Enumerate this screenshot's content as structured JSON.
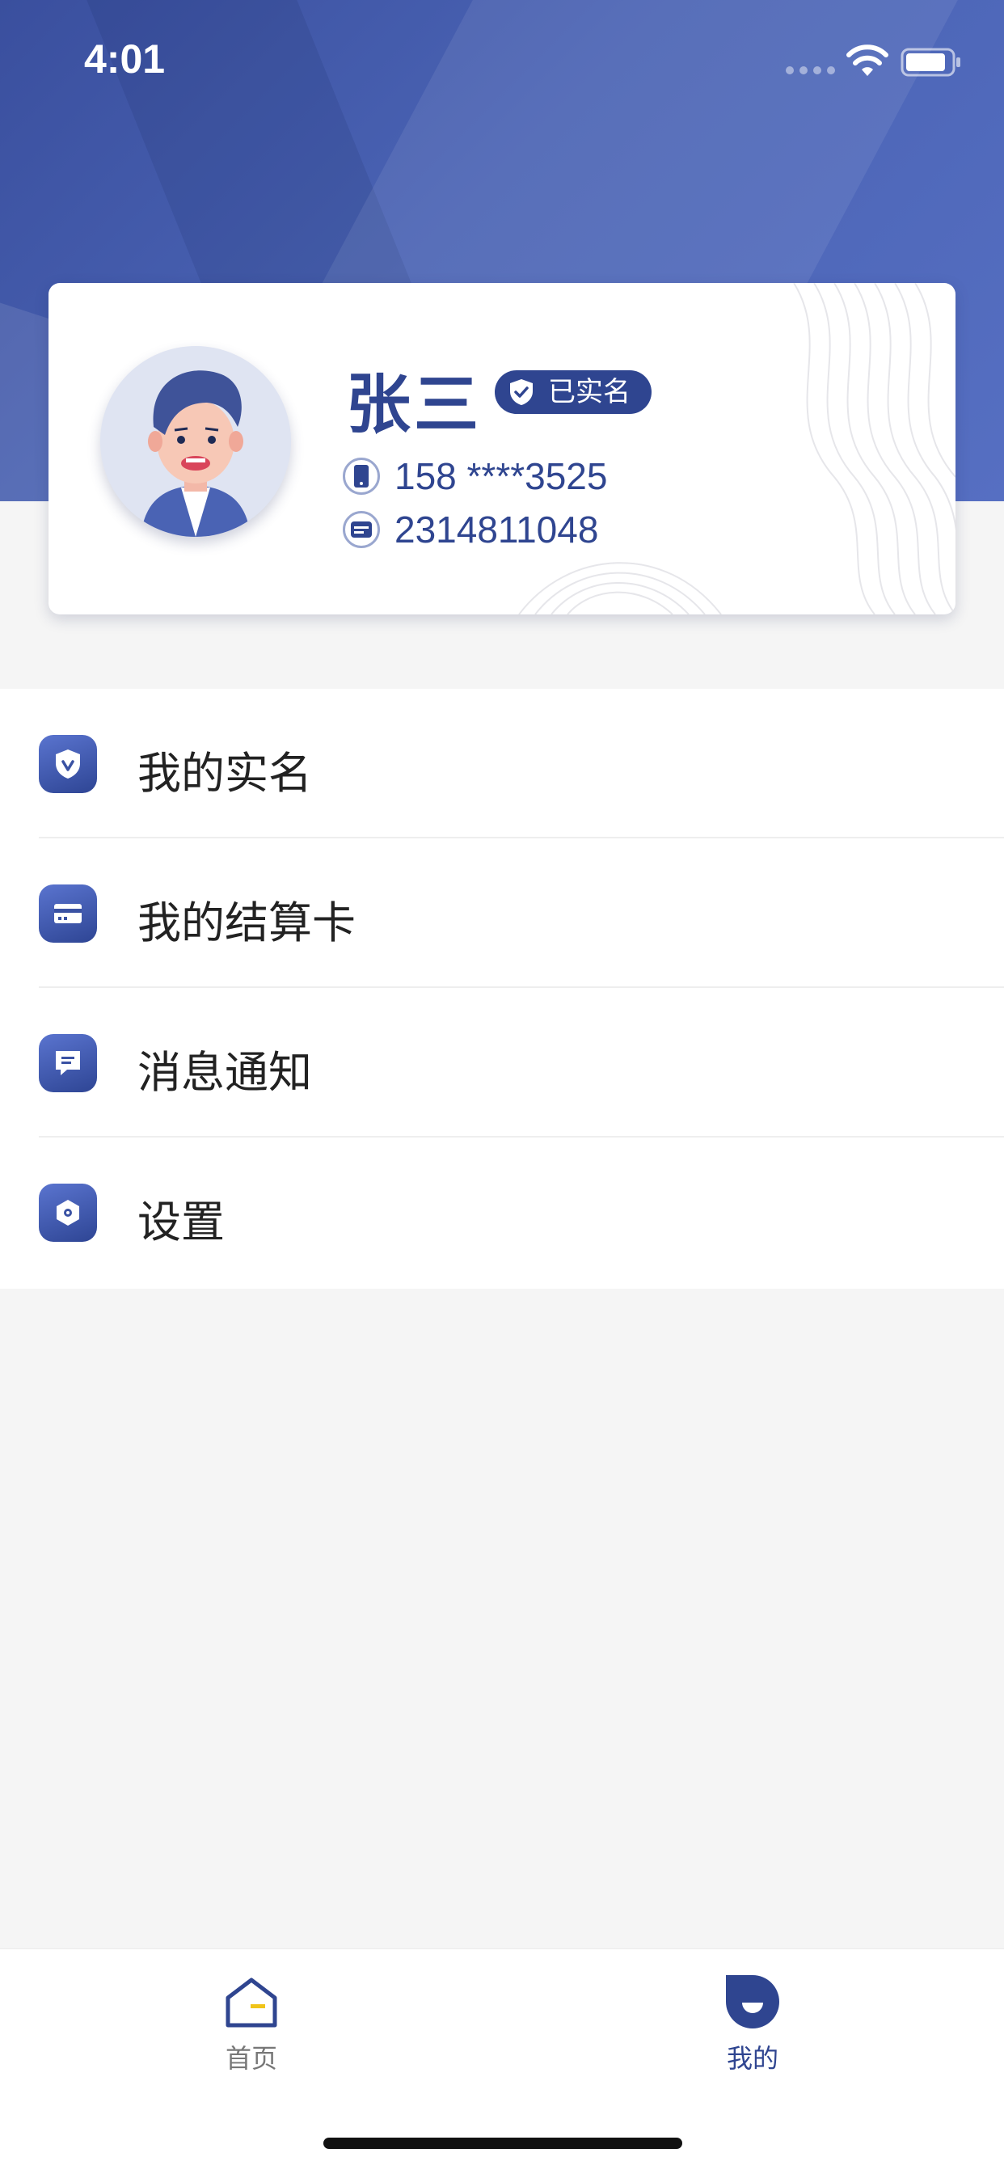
{
  "status_bar": {
    "time": "4:01"
  },
  "profile": {
    "name": "张三",
    "verified_label": "已实名",
    "phone": "158 ****3525",
    "account_id": "2314811048"
  },
  "menu": {
    "items": [
      {
        "label": "我的实名",
        "icon": "shield-check-icon"
      },
      {
        "label": "我的结算卡",
        "icon": "card-icon"
      },
      {
        "label": "消息通知",
        "icon": "message-icon"
      },
      {
        "label": "设置",
        "icon": "gear-icon"
      }
    ]
  },
  "tab_bar": {
    "tabs": [
      {
        "label": "首页",
        "active": false,
        "icon": "home-icon"
      },
      {
        "label": "我的",
        "active": true,
        "icon": "profile-icon"
      }
    ]
  },
  "colors": {
    "accent": "#2f4590",
    "header": "#4a63b4",
    "home_accent": "#f0c419"
  }
}
